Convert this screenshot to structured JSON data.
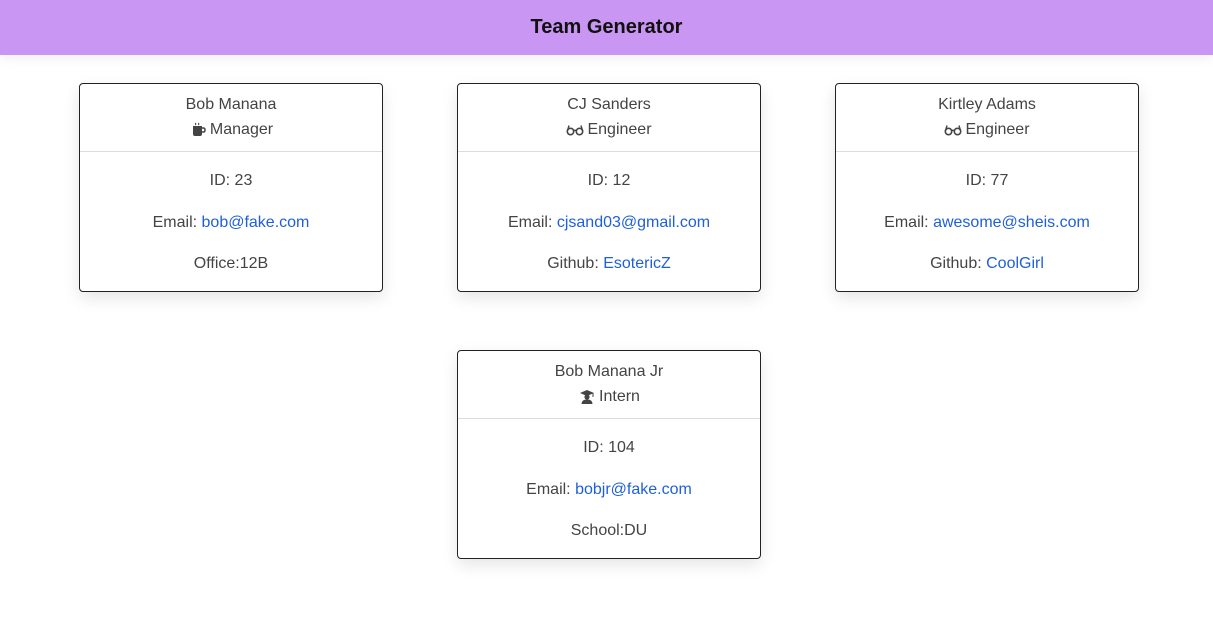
{
  "header": {
    "title": "Team Generator"
  },
  "cards": [
    {
      "name": "Bob Manana",
      "role": "Manager",
      "role_icon": "coffee-mug-icon",
      "id_label": "ID: ",
      "id": "23",
      "email_label": "Email: ",
      "email": "bob@fake.com",
      "extra_label": "Office:",
      "extra_value": "12B"
    },
    {
      "name": "CJ Sanders",
      "role": "Engineer",
      "role_icon": "glasses-icon",
      "id_label": "ID: ",
      "id": "12",
      "email_label": "Email: ",
      "email": "cjsand03@gmail.com",
      "extra_label": "Github: ",
      "extra_value": "EsotericZ"
    },
    {
      "name": "Kirtley Adams",
      "role": "Engineer",
      "role_icon": "glasses-icon",
      "id_label": "ID: ",
      "id": "77",
      "email_label": "Email: ",
      "email": "awesome@sheis.com",
      "extra_label": "Github: ",
      "extra_value": "CoolGirl"
    },
    {
      "name": "Bob Manana Jr",
      "role": "Intern",
      "role_icon": "graduate-icon",
      "id_label": "ID: ",
      "id": "104",
      "email_label": "Email: ",
      "email": "bobjr@fake.com",
      "extra_label": "School:",
      "extra_value": "DU"
    }
  ],
  "colors": {
    "header_bg": "#c996f4",
    "link": "#1f5fdc",
    "text": "#444444"
  }
}
